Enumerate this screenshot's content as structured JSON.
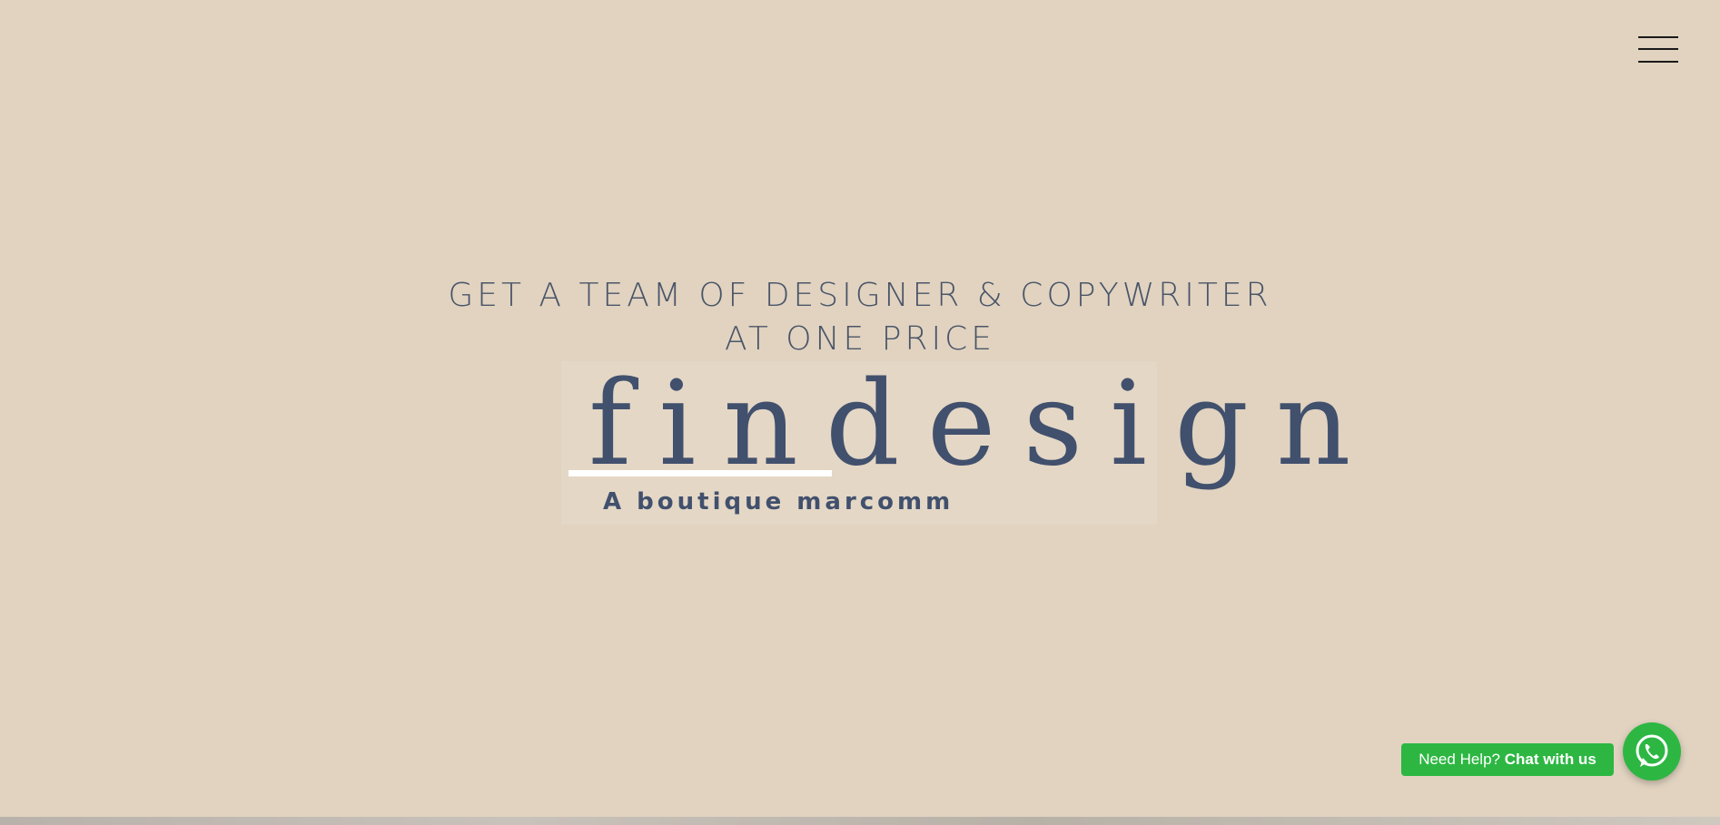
{
  "header": {
    "menu_icon": "hamburger-menu-icon"
  },
  "hero": {
    "heading_line1": "GET A TEAM OF DESIGNER & COPYWRITER",
    "heading_line2": "AT ONE PRICE"
  },
  "logo": {
    "wordmark": "findesign",
    "tagline": "A boutique marcomm"
  },
  "chat_widget": {
    "prefix": "Need Help?",
    "cta": "Chat with us",
    "icon": "whatsapp-icon"
  },
  "colors": {
    "background": "#e1d3c0",
    "brand_navy": "#41506d",
    "whatsapp_green": "#2db742"
  }
}
